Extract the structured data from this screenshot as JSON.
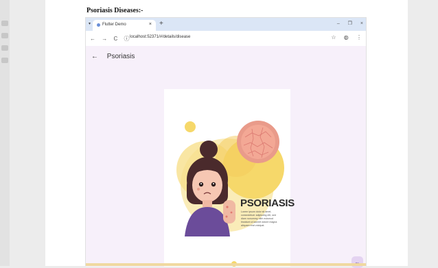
{
  "document": {
    "heading": "Psoriasis Diseases:-"
  },
  "browser": {
    "tab_title": "Flutter Demo",
    "tab_close": "×",
    "new_tab": "+",
    "tab_list": "▾",
    "window_controls": [
      "–",
      "❐",
      "×"
    ],
    "url": "localhost:52371/#/details/disease",
    "nav_icons": [
      "←",
      "→",
      "C",
      "ⓘ"
    ],
    "address_right_icons": [
      "☆",
      "◍",
      "⋮"
    ]
  },
  "app": {
    "back_arrow": "←",
    "title": "Psoriasis",
    "illustration": {
      "headline": "PSORIASIS",
      "body": "Lorem ipsum dolor sit amet, consectetuer adipiscing elit, sed diam nonummy nibh euismod tincidunt ut laoreet dolore magna aliquam erat volutpat."
    },
    "fab_icon": "←"
  },
  "colors": {
    "tabbar": "#dbe6f6",
    "app_background": "#f7f0fa",
    "illustration_yellow": "#f6dc7e",
    "skin_pink": "#ee8f85",
    "shirt_purple": "#6b4c9a",
    "fab_background": "#e4d3f1"
  }
}
